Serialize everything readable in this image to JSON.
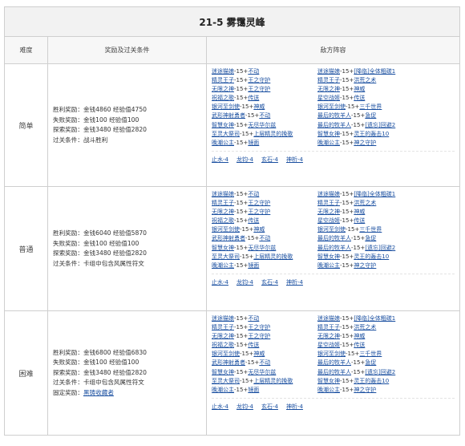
{
  "title": "21-5 雾霭灵峰",
  "headers": {
    "difficulty": "难度",
    "rewards": "奖励及过关条件",
    "enemies": "敌方阵容"
  },
  "rows": [
    {
      "difficulty": "简单",
      "rewards": [
        {
          "k": "胜利奖励：",
          "v": "金钱4860 经验值4750"
        },
        {
          "k": "失败奖励：",
          "v": "金钱100 经验值100"
        },
        {
          "k": "探索奖励：",
          "v": "金钱3480 经验值2820"
        },
        {
          "k": "过关条件：",
          "v": "战斗胜利"
        }
      ],
      "enemies": [
        {
          "name": "迷途猫娘",
          "lv": "-15+",
          "skill": "不动"
        },
        {
          "name": "[降临]全体粗碳1",
          "lv": "迷途猫娘-15+",
          "skill": ""
        },
        {
          "name": "精灵王子",
          "lv": "-15+",
          "skill": "王之守护"
        },
        {
          "name": "精灵王子",
          "lv": "-15+",
          "skill": "洪荒之术"
        },
        {
          "name": "无限之神",
          "lv": "-15+",
          "skill": "王之守护"
        },
        {
          "name": "无限之神",
          "lv": "-15+",
          "skill": "神威"
        },
        {
          "name": "祝福之歌",
          "lv": "-15+",
          "skill": "传送"
        },
        {
          "name": "星空战姬",
          "lv": "-15+",
          "skill": "传送"
        },
        {
          "name": "银河至剑使",
          "lv": "-15+",
          "skill": "神威"
        },
        {
          "name": "银河至剑使",
          "lv": "-15+",
          "skill": "三千世界"
        },
        {
          "name": "武形神射勇者",
          "lv": "-15+",
          "skill": "不动"
        },
        {
          "name": "武形神射勇者",
          "lv": "-15+",
          "skill": "急促"
        },
        {
          "name": "智慧女神",
          "lv": "-15+",
          "skill": "无尽华尔兹"
        },
        {
          "name": "最后的牧羊人",
          "lv": "-15+",
          "skill": "[遗忘]回避2"
        },
        {
          "name": "至灵大祭司",
          "lv": "-15+",
          "skill": "上层精灵的挽歌"
        },
        {
          "name": "智慧女神",
          "lv": "-15+",
          "skill": "灵王的轰击10"
        },
        {
          "name": "晚潮公主",
          "lv": "-15+",
          "skill": "镜面"
        },
        {
          "name": "晚潮公主",
          "lv": "-15+",
          "skill": "神之守护"
        }
      ],
      "terrain": [
        "止水-4",
        "龙钧-4",
        "玄石-4",
        "神析-4"
      ]
    },
    {
      "difficulty": "普通",
      "rewards": [
        {
          "k": "胜利奖励：",
          "v": "金钱6040 经验值5870"
        },
        {
          "k": "失败奖励：",
          "v": "金钱100 经验值100"
        },
        {
          "k": "探索奖励：",
          "v": "金钱3480 经验值2820"
        },
        {
          "k": "过关条件：",
          "v": "卡组中包含风属性符文"
        }
      ],
      "enemies": [
        {
          "name": "迷途猫娘",
          "lv": "-15+",
          "skill": "不动"
        },
        {
          "name": "迷途猫娘",
          "lv": "-15+",
          "skill": "[降临]全体粗碳1"
        },
        {
          "name": "精灵王子",
          "lv": "-15+",
          "skill": "王之守护"
        },
        {
          "name": "精灵王子",
          "lv": "-15+",
          "skill": "洪荒之术"
        },
        {
          "name": "无限之神",
          "lv": "-15+",
          "skill": "王之守护"
        },
        {
          "name": "无限之神",
          "lv": "-15+",
          "skill": "神威"
        },
        {
          "name": "祝福之歌",
          "lv": "-15+",
          "skill": "传送"
        },
        {
          "name": "星空战姬",
          "lv": "-15+",
          "skill": "传送"
        },
        {
          "name": "银河至剑使",
          "lv": "-15+",
          "skill": "神威"
        },
        {
          "name": "银河至剑使",
          "lv": "-15+",
          "skill": "三千世界"
        },
        {
          "name": "武形神射勇者",
          "lv": "-15+",
          "skill": "不动"
        },
        {
          "name": "最后的牧羊人",
          "lv": "-15+",
          "skill": "急促"
        },
        {
          "name": "智慧女神",
          "lv": "-15+",
          "skill": "无尽华尔兹"
        },
        {
          "name": "最后的牧羊人",
          "lv": "-15+",
          "skill": "[遗忘]回避2"
        },
        {
          "name": "至灵大祭司",
          "lv": "-15+",
          "skill": "上层精灵的挽歌"
        },
        {
          "name": "智慧女神",
          "lv": "-15+",
          "skill": "灵王的轰击10"
        },
        {
          "name": "晚潮公主",
          "lv": "-15+",
          "skill": "镜面"
        },
        {
          "name": "晚潮公主",
          "lv": "-15+",
          "skill": "神之守护"
        }
      ],
      "terrain": [
        "止水-4",
        "龙钧-4",
        "玄石-4",
        "神析-4"
      ]
    },
    {
      "difficulty": "困难",
      "rewards": [
        {
          "k": "胜利奖励：",
          "v": "金钱6800 经验值6830"
        },
        {
          "k": "失败奖励：",
          "v": "金钱100 经验值100"
        },
        {
          "k": "探索奖励：",
          "v": "金钱3480 经验值2820"
        },
        {
          "k": "过关条件：",
          "v": "卡组中包含风属性符文"
        },
        {
          "k": "固定奖励：",
          "v": "黑铸收藏者",
          "link": true
        }
      ],
      "enemies": [
        {
          "name": "迷途猫娘",
          "lv": "-15+",
          "skill": "不动"
        },
        {
          "name": "迷途猫娘",
          "lv": "-15+",
          "skill": "[降临]全体粗碳1"
        },
        {
          "name": "精灵王子",
          "lv": "-15+",
          "skill": "王之守护"
        },
        {
          "name": "精灵王子",
          "lv": "-15+",
          "skill": "洪荒之术"
        },
        {
          "name": "无限之神",
          "lv": "-15+",
          "skill": "王之守护"
        },
        {
          "name": "无限之神",
          "lv": "-15+",
          "skill": "神威"
        },
        {
          "name": "祝福之歌",
          "lv": "-15+",
          "skill": "传送"
        },
        {
          "name": "星空战姬",
          "lv": "-15+",
          "skill": "传送"
        },
        {
          "name": "银河至剑使",
          "lv": "-15+",
          "skill": "神威"
        },
        {
          "name": "银河至剑使",
          "lv": "-15+",
          "skill": "三千世界"
        },
        {
          "name": "武形神射勇者",
          "lv": "-15+",
          "skill": "不动"
        },
        {
          "name": "最后的牧羊人",
          "lv": "-15+",
          "skill": "急促"
        },
        {
          "name": "智慧女神",
          "lv": "-15+",
          "skill": "无尽华尔兹"
        },
        {
          "name": "最后的牧羊人",
          "lv": "-15+",
          "skill": "[遗忘]回避2"
        },
        {
          "name": "至灵大祭司",
          "lv": "-15+",
          "skill": "上层精灵的挽歌"
        },
        {
          "name": "智慧女神",
          "lv": "-15+",
          "skill": "灵王的轰击10"
        },
        {
          "name": "晚潮公主",
          "lv": "-15+",
          "skill": "镜面"
        },
        {
          "name": "晚潮公主",
          "lv": "-15+",
          "skill": "神之守护"
        }
      ],
      "terrain": [
        "止水-4",
        "龙钧-4",
        "玄石-4",
        "神析-4"
      ]
    }
  ]
}
